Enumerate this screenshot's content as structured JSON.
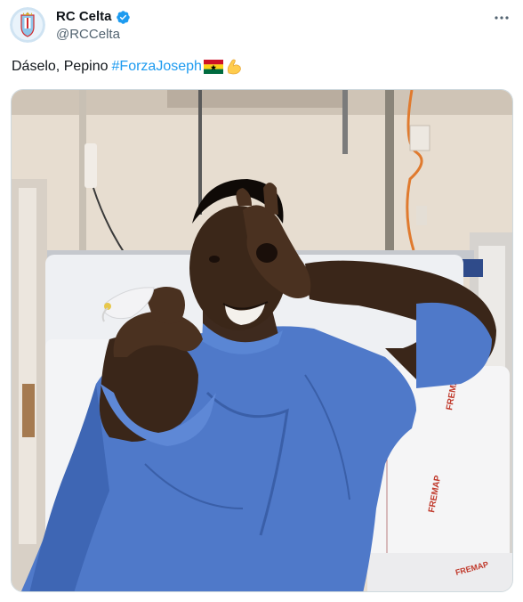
{
  "tweet": {
    "display_name": "RC Celta",
    "handle": "@RCCelta",
    "text_before": "Dáselo, Pepino",
    "hashtag": "#ForzaJoseph",
    "emojis": [
      "ghana-flag-icon",
      "flexed-biceps-icon"
    ],
    "verified": true,
    "media": {
      "alt": "",
      "printed_text": [
        "FREMAP",
        "FREMAP",
        "FREMAP"
      ]
    }
  },
  "colors": {
    "accent": "#1d9bf0",
    "secondary_text": "#536471",
    "primary_text": "#0f1419",
    "gown_blue": "#4f79c9"
  }
}
